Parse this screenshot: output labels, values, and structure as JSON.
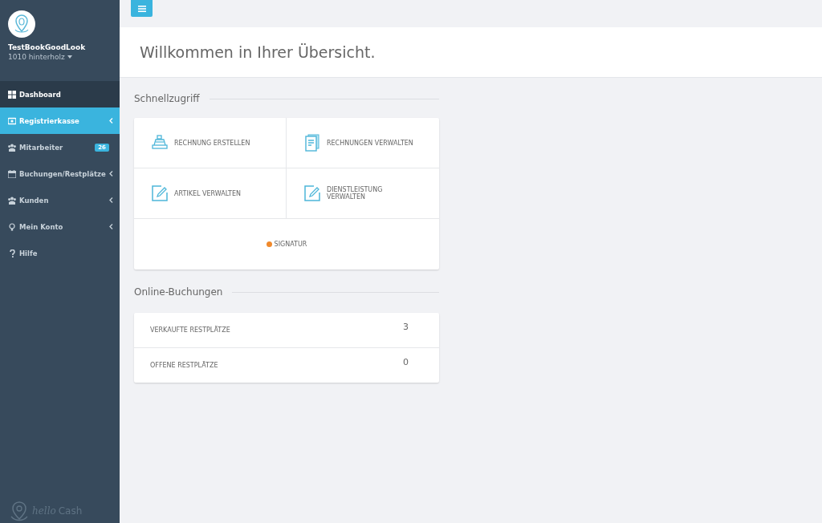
{
  "sidebar": {
    "account": {
      "name": "TestBookGoodLook",
      "location": "1010 hinterholz"
    },
    "items": [
      {
        "label": "Dashboard",
        "kind": "heading",
        "selected": false,
        "submenu": false
      },
      {
        "label": "Registrierkasse",
        "kind": "link",
        "selected": true,
        "submenu": true
      },
      {
        "label": "Mitarbeiter",
        "kind": "link",
        "selected": false,
        "submenu": false,
        "badge": "26"
      },
      {
        "label": "Buchungen/Restplätze",
        "kind": "link",
        "selected": false,
        "submenu": true
      },
      {
        "label": "Kunden",
        "kind": "link",
        "selected": false,
        "submenu": true
      },
      {
        "label": "Mein Konto",
        "kind": "link",
        "selected": false,
        "submenu": true
      },
      {
        "label": "Hilfe",
        "kind": "link",
        "selected": false,
        "submenu": false
      }
    ],
    "footer_logo": {
      "word_1": "hello",
      "word_2": "Cash"
    }
  },
  "header": {
    "title": "Willkommen in Ihrer Übersicht."
  },
  "quick_access": {
    "heading": "Schnellzugriff",
    "tiles": [
      {
        "label": "RECHNUNG ERSTELLEN",
        "kind": "register"
      },
      {
        "label": "RECHNUNGEN VERWALTEN",
        "kind": "invoices"
      },
      {
        "label": "ARTIKEL VERWALTEN",
        "kind": "edit"
      },
      {
        "label": "DIENSTLEISTUNG VERWALTEN",
        "kind": "edit"
      },
      {
        "label": "SIGNATUR",
        "kind": "status",
        "color": "#f0892b"
      }
    ]
  },
  "online_bookings": {
    "heading": "Online-Buchungen",
    "rows": [
      {
        "label": "VERKAUFTE RESTPLÄTZE",
        "value": "3"
      },
      {
        "label": "OFFENE RESTPLÄTZE",
        "value": "0"
      }
    ]
  }
}
